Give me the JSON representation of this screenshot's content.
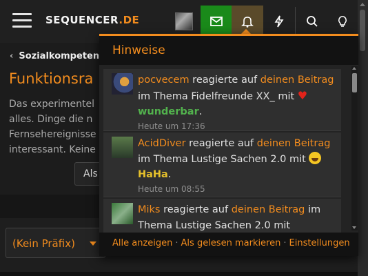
{
  "header": {
    "logo_pre": "SE",
    "logo_mid": "QUENCER",
    "logo_post": ".DE",
    "icons": [
      "menu-icon",
      "inbox-icon",
      "bell-icon",
      "bolt-icon",
      "search-icon",
      "lightbulb-icon"
    ],
    "accent": "#f28c1e",
    "inbox_color": "#1a8a1a"
  },
  "page": {
    "breadcrumb": "Sozialkompetenz",
    "title": "Funktionsra",
    "intro_lines": [
      "Das experimentel",
      "alles. Dinge die n",
      "Fernsehereignisse",
      "interessant. Keine"
    ],
    "button_partial": "Als",
    "prefix_select": "(Kein Präfix)"
  },
  "popup": {
    "title": "Hinweise",
    "items": [
      {
        "user": "pocvecem",
        "verb": " reagierte auf ",
        "link1": "dei­nen",
        "link2": "Beitrag",
        "rest": " im Thema Fidelfreunde XX_ mit ",
        "reaction": "wunderbar",
        "time": "Heute um 17:36"
      },
      {
        "user": "AcidDiver",
        "verb": " reagierte auf ",
        "link1": "deinen Beitrag",
        "rest": " im Thema Lustige Sachen 2.0 mit ",
        "reaction": "HaHa",
        "time": "Heute um 08:55"
      },
      {
        "user": "Miks",
        "verb": " reagierte auf ",
        "link1": "deinen Beitrag",
        "rest": " im Thema Lustige Sachen 2.0 mit"
      }
    ],
    "footer": {
      "show_all": "Alle anzeigen",
      "mark_read": "Als gelesen markieren",
      "settings": "Einstellungen"
    }
  }
}
